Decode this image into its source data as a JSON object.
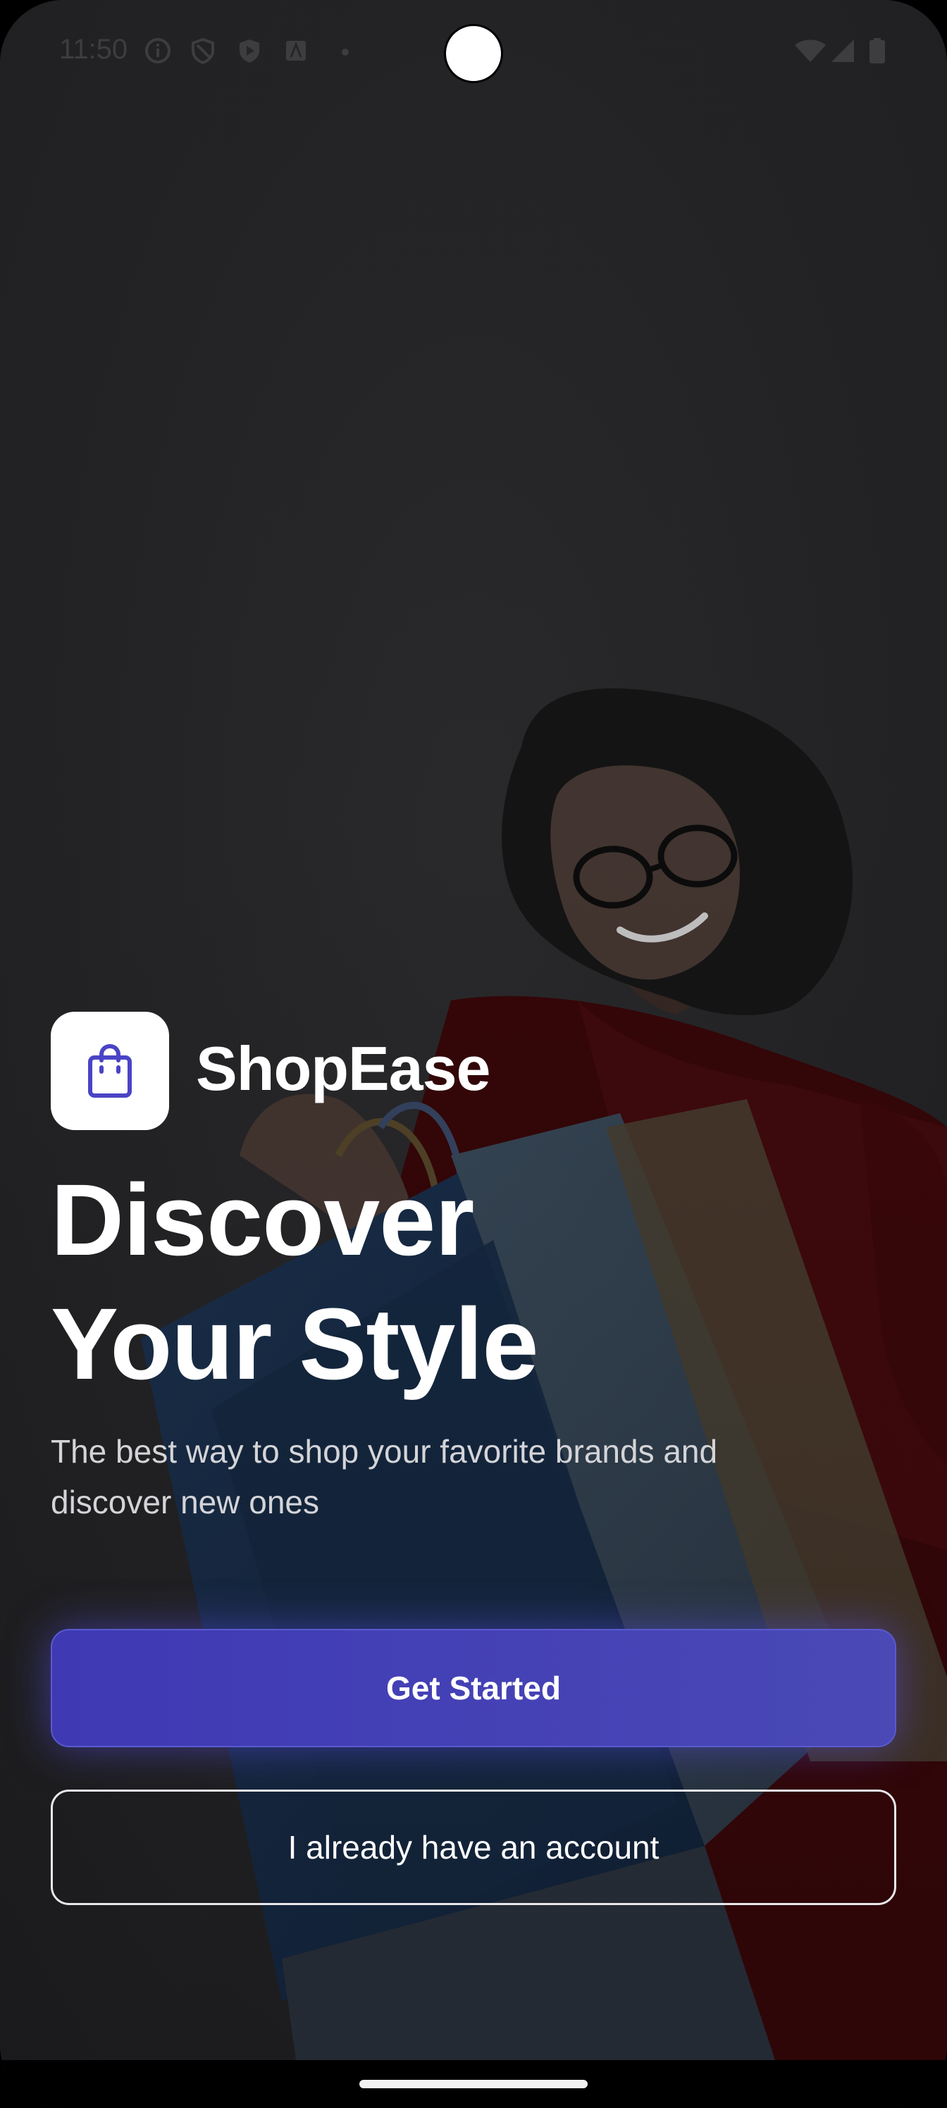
{
  "status_bar": {
    "time": "11:50",
    "left_icons": [
      "info-icon",
      "shield-icon",
      "play-protect-icon",
      "android-icon",
      "dot-icon"
    ],
    "right_icons": [
      "wifi-icon",
      "signal-icon",
      "battery-icon"
    ]
  },
  "app": {
    "name": "ShopEase",
    "logo_icon": "shopping-bag-icon",
    "accent": "#4a44c6"
  },
  "hero": {
    "headline_line1": "Discover",
    "headline_line2": "Your Style",
    "subtitle": "The best way to shop your favorite brands and discover new ones"
  },
  "actions": {
    "primary_label": "Get Started",
    "secondary_label": "I already have an account"
  }
}
